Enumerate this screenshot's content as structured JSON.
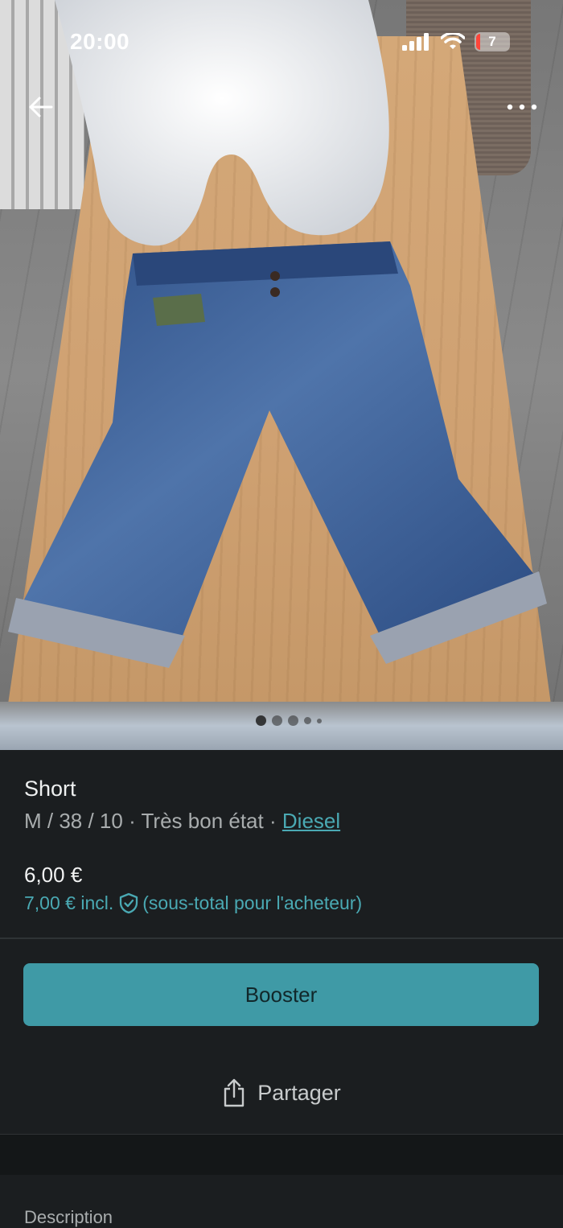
{
  "status_bar": {
    "time": "20:00",
    "battery_level": "7"
  },
  "product": {
    "title": "Short",
    "size": "M / 38 / 10",
    "separator": "·",
    "condition": "Très bon état",
    "brand": "Diesel",
    "price": "6,00 €",
    "price_incl": "7,00 € incl.",
    "price_incl_note": "(sous-total pour l'acheteur)"
  },
  "gallery": {
    "total_images": 5,
    "active_index": 0
  },
  "actions": {
    "boost_label": "Booster",
    "share_label": "Partager"
  },
  "section": {
    "description_label": "Description"
  },
  "colors": {
    "background": "#1b1e20",
    "accent": "#3f9aa6",
    "link": "#4aa9b3",
    "battery_low": "#ff453a"
  },
  "icons": {
    "back": "arrow-left-icon",
    "more": "more-horizontal-icon",
    "shield": "shield-check-icon",
    "share": "share-icon"
  }
}
